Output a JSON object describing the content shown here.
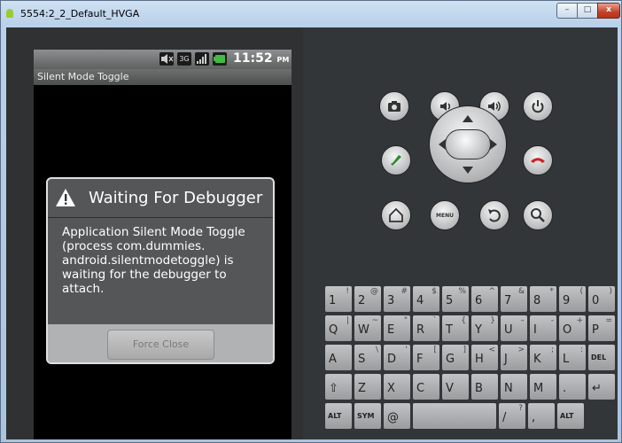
{
  "window": {
    "title": "5554:2_2_Default_HVGA",
    "minimize": "–",
    "maximize": "□",
    "close": "x"
  },
  "device": {
    "status_time": "11:52",
    "status_ampm": "PM",
    "status_net": "3G",
    "app_title": "Silent Mode Toggle"
  },
  "dialog": {
    "title": "Waiting For Debugger",
    "message": "Application Silent Mode Toggle (process com.dummies. android.silentmodetoggle) is waiting for the debugger to attach.",
    "button": "Force Close"
  },
  "controls": {
    "menu_label": "MENU"
  },
  "keyboard": {
    "rows": [
      [
        [
          "1",
          "!"
        ],
        [
          "2",
          "@"
        ],
        [
          "3",
          "#"
        ],
        [
          "4",
          "$"
        ],
        [
          "5",
          "%"
        ],
        [
          "6",
          "^"
        ],
        [
          "7",
          "&"
        ],
        [
          "8",
          "*"
        ],
        [
          "9",
          "("
        ],
        [
          "0",
          ")"
        ]
      ],
      [
        [
          "Q",
          "|"
        ],
        [
          "W",
          "~"
        ],
        [
          "E",
          "\""
        ],
        [
          "R",
          "`"
        ],
        [
          "T",
          "{"
        ],
        [
          "Y",
          "}"
        ],
        [
          "U",
          "–"
        ],
        [
          "I",
          "-"
        ],
        [
          "O",
          "+"
        ],
        [
          "P",
          "="
        ]
      ],
      [
        [
          "A",
          ""
        ],
        [
          "S",
          "\\"
        ],
        [
          "D",
          "'"
        ],
        [
          "F",
          "["
        ],
        [
          "G",
          "]"
        ],
        [
          "H",
          "<"
        ],
        [
          "J",
          ">"
        ],
        [
          "K",
          ";"
        ],
        [
          "L",
          ":"
        ],
        [
          "DEL",
          ""
        ]
      ],
      [
        [
          "⇧",
          ""
        ],
        [
          "Z",
          ""
        ],
        [
          "X",
          ""
        ],
        [
          "C",
          ""
        ],
        [
          "V",
          ""
        ],
        [
          "B",
          ""
        ],
        [
          "N",
          ""
        ],
        [
          "M",
          ""
        ],
        [
          ".",
          ""
        ],
        [
          "↵",
          ""
        ]
      ],
      [
        [
          "ALT",
          ""
        ],
        [
          "SYM",
          ""
        ],
        [
          "@",
          ""
        ],
        [
          "",
          ""
        ],
        [
          "/",
          "?"
        ],
        [
          ",",
          ""
        ],
        [
          "ALT",
          ""
        ]
      ]
    ]
  }
}
